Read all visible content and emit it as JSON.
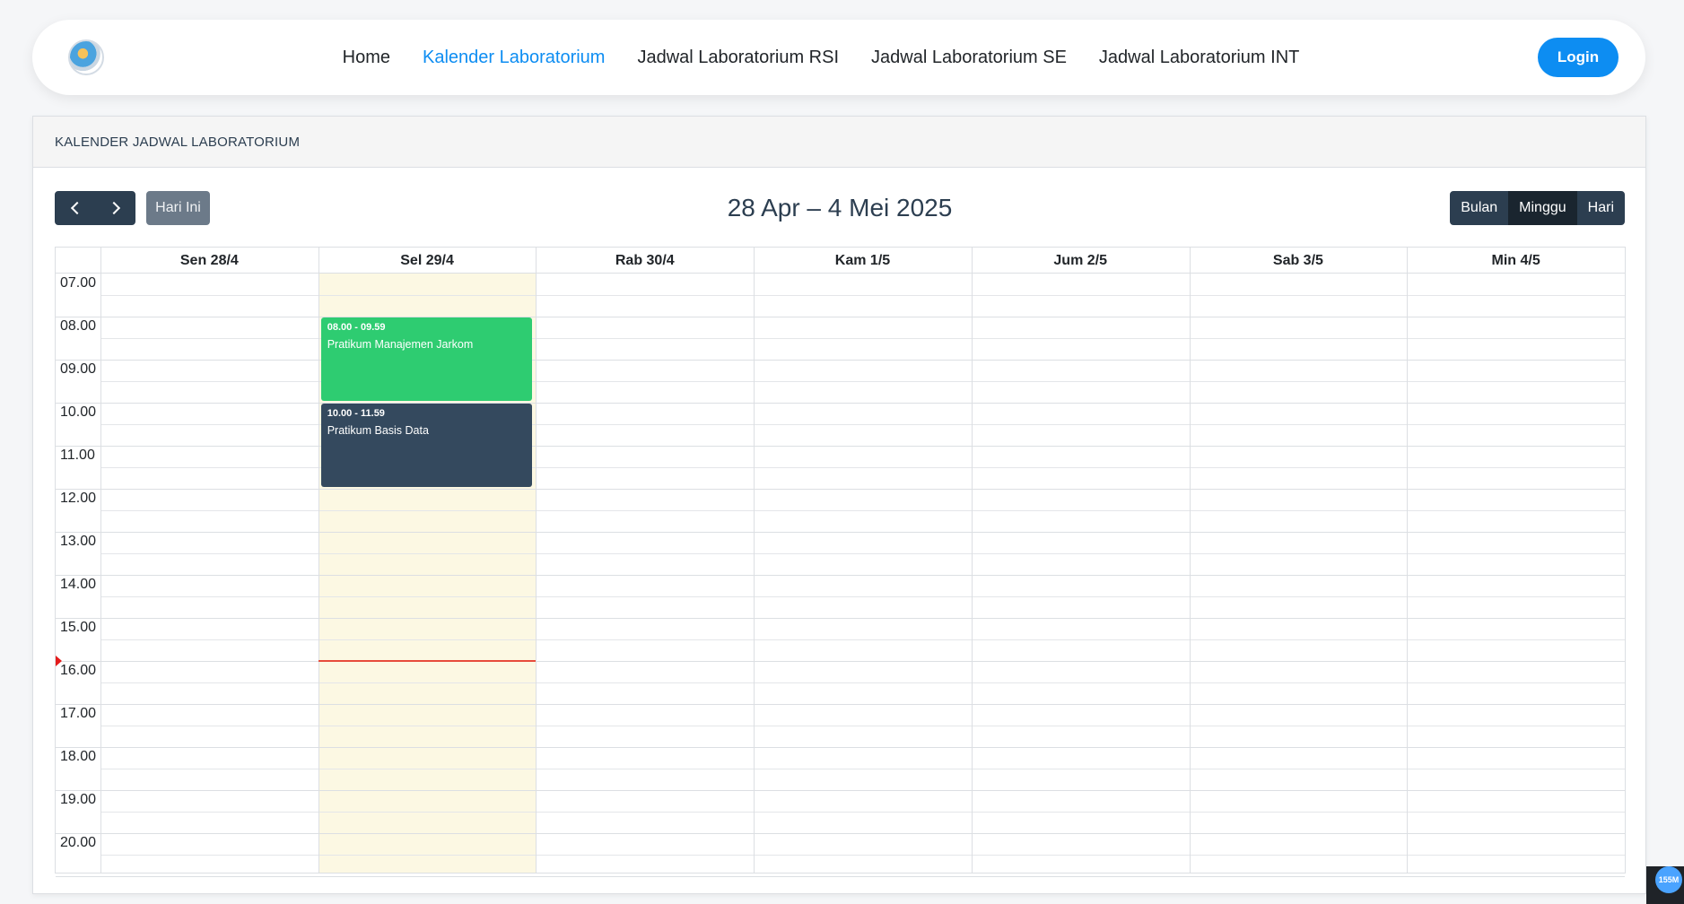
{
  "navbar": {
    "links": [
      "Home",
      "Kalender Laboratorium",
      "Jadwal Laboratorium RSI",
      "Jadwal Laboratorium SE",
      "Jadwal Laboratorium INT"
    ],
    "active_link": "Kalender Laboratorium",
    "login_label": "Login"
  },
  "card": {
    "header": "KALENDER JADWAL LABORATORIUM"
  },
  "toolbar": {
    "today_label": "Hari Ini",
    "title": "28 Apr – 4 Mei 2025",
    "views": [
      "Bulan",
      "Minggu",
      "Hari"
    ],
    "active_view": "Minggu"
  },
  "calendar": {
    "days": [
      "Sen 28/4",
      "Sel 29/4",
      "Rab 30/4",
      "Kam 1/5",
      "Jum 2/5",
      "Sab 3/5",
      "Min 4/5"
    ],
    "today_index": 1,
    "times": [
      "07.00",
      "08.00",
      "09.00",
      "10.00",
      "11.00",
      "12.00",
      "13.00",
      "14.00",
      "15.00",
      "16.00",
      "17.00",
      "18.00",
      "19.00",
      "20.00"
    ],
    "now_time": "15.97",
    "events": [
      {
        "time": "08.00 - 09.59",
        "title": "Pratikum Manajemen Jarkom",
        "day_index": 1,
        "start": 8.0,
        "end": 10.0,
        "color": "#2ecc71"
      },
      {
        "time": "10.00 - 11.59",
        "title": "Pratikum Basis Data",
        "day_index": 1,
        "start": 10.0,
        "end": 12.0,
        "color": "#34495e"
      }
    ]
  },
  "corner_badge": "155M",
  "colors": {
    "accent": "#0d8df2",
    "toolbar_button": "#2c3e50",
    "today_highlight": "#fcf8e3",
    "now_indicator": "#e74c3c"
  }
}
